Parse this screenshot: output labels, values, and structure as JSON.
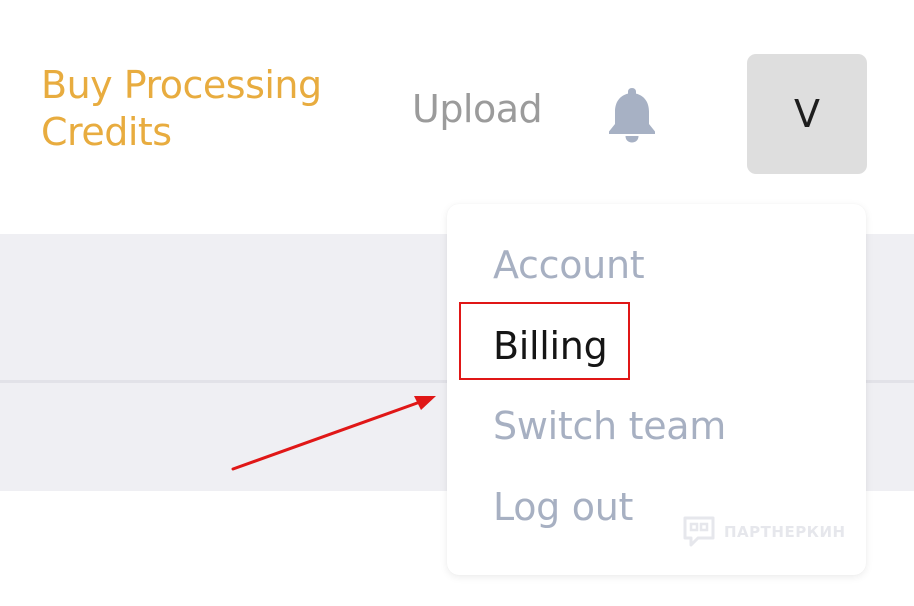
{
  "header": {
    "buy_credits_line1": "Buy Processing",
    "buy_credits_line2": "Credits",
    "upload_label": "Upload",
    "bell_icon": "bell-icon",
    "avatar_initial": "V"
  },
  "dropdown": {
    "items": [
      {
        "label": "Account",
        "active": false
      },
      {
        "label": "Billing",
        "active": true
      },
      {
        "label": "Switch team",
        "active": false
      },
      {
        "label": "Log out",
        "active": false
      }
    ]
  },
  "annotation": {
    "highlighted_item": "Billing",
    "color": "#e01717"
  },
  "watermark": {
    "text": "ПАРТНЕРКИН"
  },
  "colors": {
    "accent": "#e8ac3f",
    "muted_text": "#9b9b9b",
    "menu_text": "#a7b0c2",
    "active_text": "#151515",
    "avatar_bg": "#dedede",
    "band_bg": "#efeff3"
  }
}
